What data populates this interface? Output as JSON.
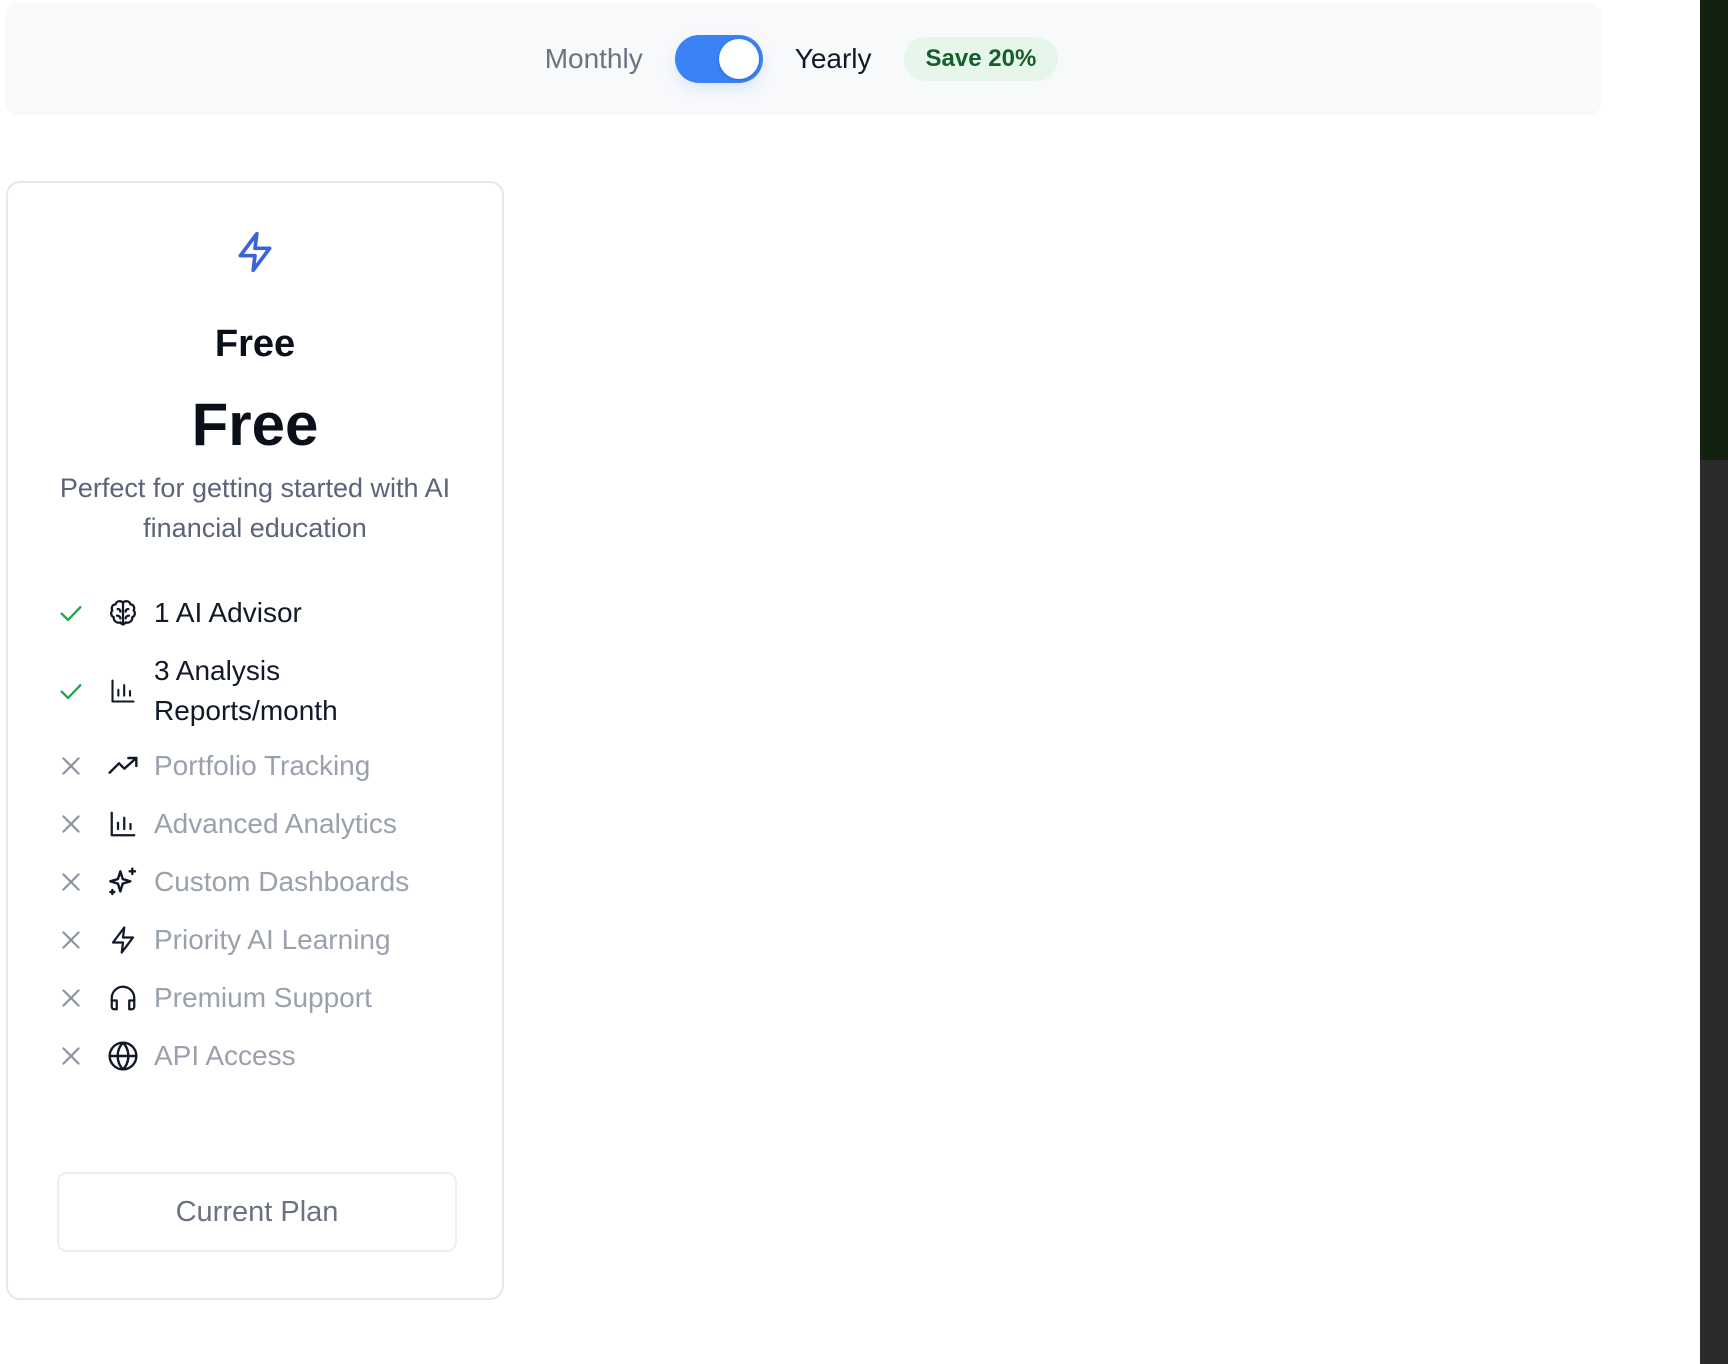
{
  "billing": {
    "monthly_label": "Monthly",
    "yearly_label": "Yearly",
    "save_badge": "Save 20%",
    "toggle_state": "yearly",
    "accent_color": "#3b82f6"
  },
  "plan": {
    "icon": "lightning-icon",
    "name": "Free",
    "price": "Free",
    "description": "Perfect for getting started with AI financial education",
    "features": [
      {
        "label": "1 AI Advisor",
        "included": true,
        "icon": "brain-icon"
      },
      {
        "label": "3 Analysis Reports/month",
        "included": true,
        "icon": "bar-chart-icon"
      },
      {
        "label": "Portfolio Tracking",
        "included": false,
        "icon": "trending-up-icon"
      },
      {
        "label": "Advanced Analytics",
        "included": false,
        "icon": "bar-chart-icon"
      },
      {
        "label": "Custom Dashboards",
        "included": false,
        "icon": "sparkles-icon"
      },
      {
        "label": "Priority AI Learning",
        "included": false,
        "icon": "lightning-icon"
      },
      {
        "label": "Premium Support",
        "included": false,
        "icon": "headphones-icon"
      },
      {
        "label": "API Access",
        "included": false,
        "icon": "globe-icon"
      }
    ],
    "button_label": "Current Plan"
  },
  "colors": {
    "check": "#22a447",
    "cross": "#8b93a0",
    "badge_bg": "#e6f6ea",
    "badge_text": "#15602a"
  }
}
